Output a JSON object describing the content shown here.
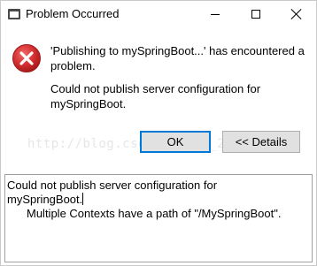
{
  "window": {
    "title": "Problem Occurred"
  },
  "icons": {
    "app": "dialog-app-icon",
    "error": "error-icon",
    "minimize": "minimize-icon",
    "maximize": "maximize-icon",
    "close": "close-icon"
  },
  "colors": {
    "error_red": "#d32f2f",
    "focus_border": "#0078d7",
    "button_bg": "#e1e1e1"
  },
  "message": {
    "primary": "'Publishing to mySpringBoot...' has encountered a problem.",
    "secondary": "Could not publish server configuration for mySpringBoot."
  },
  "watermark": "http://blog.csdn.net/qq_27469430",
  "buttons": {
    "ok": "OK",
    "details": "<< Details"
  },
  "details": {
    "line1": "Could not publish server configuration for",
    "line2": "mySpringBoot.",
    "line3": "Multiple Contexts have a path of \"/MySpringBoot\"."
  }
}
